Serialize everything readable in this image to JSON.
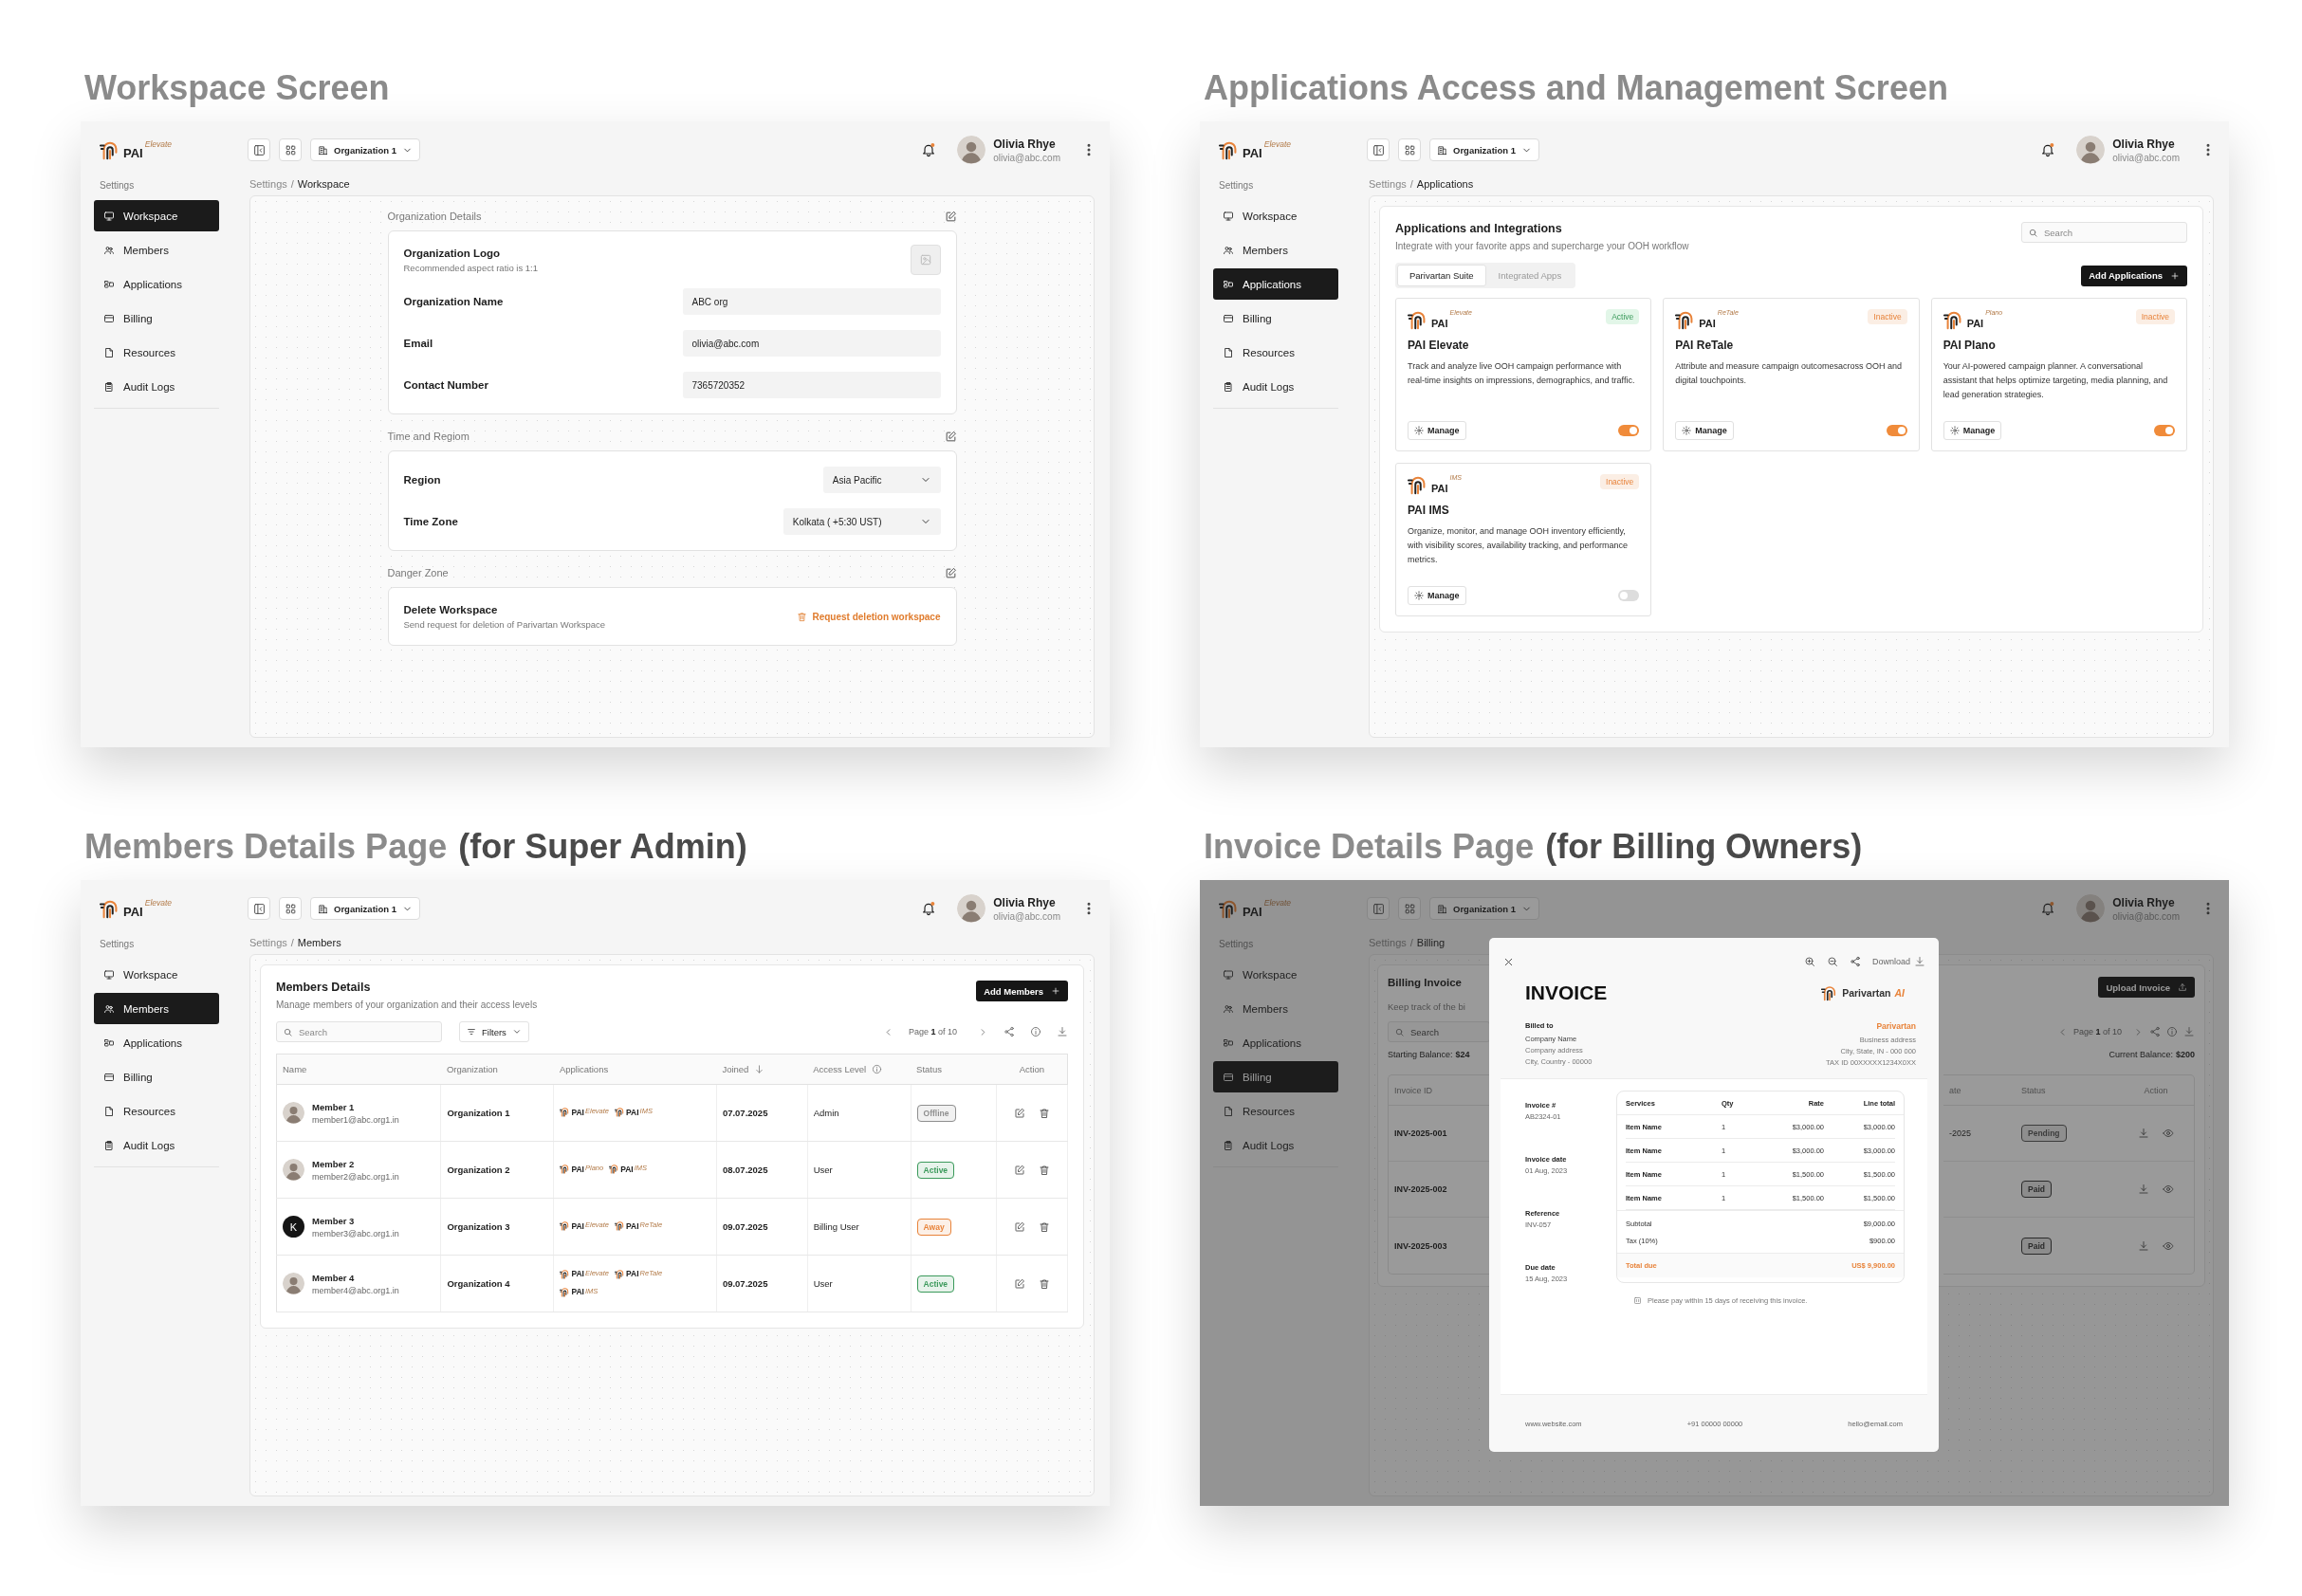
{
  "panels": [
    {
      "kind": "workspace",
      "title": "Workspace Screen",
      "header": {
        "logo": {
          "brand": "PAI",
          "product": "Elevate"
        },
        "organization": "Organization 1",
        "unread": true,
        "user": {
          "name": "Olivia Rhye",
          "email": "olivia@abc.com"
        }
      },
      "sidebar": {
        "heading": "Settings",
        "items": [
          {
            "label": "Workspace",
            "selected": true
          },
          {
            "label": "Members",
            "selected": false
          },
          {
            "label": "Applications",
            "selected": false
          },
          {
            "label": "Billing",
            "selected": false
          },
          {
            "label": "Resources",
            "selected": false
          },
          {
            "label": "Audit Logs",
            "selected": false
          }
        ]
      },
      "breadcrumb": {
        "separator": "/",
        "items": [
          "Settings",
          "Workspace"
        ]
      },
      "sections": [
        {
          "heading": "Organization Details",
          "rows": [
            {
              "kind": "logo",
              "label": "Organization Logo",
              "hint": "Recommended aspect ratio is 1:1"
            },
            {
              "kind": "field",
              "label": "Organization Name",
              "value": "ABC org"
            },
            {
              "kind": "field",
              "label": "Email",
              "value": "olivia@abc.com"
            },
            {
              "kind": "field",
              "label": "Contact Number",
              "value": "7365720352"
            }
          ]
        },
        {
          "heading": "Time and Regiom",
          "rows": [
            {
              "kind": "select",
              "label": "Region",
              "value": "Asia Pacific"
            },
            {
              "kind": "select",
              "label": "Time Zone",
              "value": "Kolkata ( +5:30 UST)"
            }
          ]
        },
        {
          "heading": "Danger Zone",
          "rows": [
            {
              "kind": "danger",
              "label": "Delete Workspace",
              "hint": "Send request for deletion of Parivartan Workspace",
              "action": "Request deletion workspace"
            }
          ]
        }
      ]
    },
    {
      "kind": "applications",
      "title": "Applications Access and Management Screen",
      "header": {
        "logo": {
          "brand": "PAI",
          "product": "Elevate"
        },
        "organization": "Organization 1",
        "unread": true,
        "user": {
          "name": "Olivia Rhye",
          "email": "olivia@abc.com"
        }
      },
      "sidebar": {
        "heading": "Settings",
        "items": [
          {
            "label": "Workspace",
            "selected": false
          },
          {
            "label": "Members",
            "selected": false
          },
          {
            "label": "Applications",
            "selected": true
          },
          {
            "label": "Billing",
            "selected": false
          },
          {
            "label": "Resources",
            "selected": false
          },
          {
            "label": "Audit Logs",
            "selected": false
          }
        ]
      },
      "breadcrumb": {
        "separator": "/",
        "items": [
          "Settings",
          "Applications"
        ]
      },
      "heading": "Applications and Integrations",
      "subtitle": "Integrate with your favorite apps and supercharge your OOH workflow",
      "search_placeholder": "Search",
      "tabs": [
        {
          "label": "Parivartan Suite",
          "selected": true
        },
        {
          "label": "Integrated Apps",
          "selected": false
        }
      ],
      "add_button": "Add Applications",
      "apps": [
        {
          "logo": {
            "brand": "PAI",
            "product": "Elevate"
          },
          "name": "PAI Elevate",
          "status": "Active",
          "active": true,
          "description": "Track and analyze live OOH campaign performance with real-time insights on impressions, demographics, and traffic.",
          "manage": "Manage",
          "on": true
        },
        {
          "logo": {
            "brand": "PAI",
            "product": "ReTale"
          },
          "name": "PAI ReTale",
          "status": "Inactive",
          "active": false,
          "description": "Attribute and measure campaign outcomesacross OOH and digital touchpoints.",
          "manage": "Manage",
          "on": true
        },
        {
          "logo": {
            "brand": "PAI",
            "product": "Plano"
          },
          "name": "PAI Plano",
          "status": "Inactive",
          "active": false,
          "description": "Your AI-powered campaign planner. A conversational assistant that helps optimize targeting, media planning, and lead generation strategies.",
          "manage": "Manage",
          "on": true
        },
        {
          "logo": {
            "brand": "PAI",
            "product": "IMS"
          },
          "name": "PAI IMS",
          "status": "Inactive",
          "active": false,
          "description": "Organize, monitor, and manage OOH inventory efficiently, with visibility scores, availability tracking, and performance metrics.",
          "manage": "Manage",
          "on": false
        }
      ]
    },
    {
      "kind": "members",
      "title": "Members Details Page",
      "title_note": "(for Super Admin)",
      "header": {
        "logo": {
          "brand": "PAI",
          "product": "Elevate"
        },
        "organization": "Organization 1",
        "unread": true,
        "user": {
          "name": "Olivia Rhye",
          "email": "olivia@abc.com"
        }
      },
      "sidebar": {
        "heading": "Settings",
        "items": [
          {
            "label": "Workspace",
            "selected": false
          },
          {
            "label": "Members",
            "selected": true
          },
          {
            "label": "Applications",
            "selected": false
          },
          {
            "label": "Billing",
            "selected": false
          },
          {
            "label": "Resources",
            "selected": false
          },
          {
            "label": "Audit Logs",
            "selected": false
          }
        ]
      },
      "breadcrumb": {
        "separator": "/",
        "items": [
          "Settings",
          "Members"
        ]
      },
      "heading": "Members Details",
      "subtitle": "Manage members of your organization and their access levels",
      "add_button": "Add Members",
      "search_placeholder": "Search",
      "filters": "Filters",
      "pager": "Page **1** of 10",
      "columns": [
        {
          "label": "Name",
          "kind": "plain"
        },
        {
          "label": "Organization",
          "kind": "plain"
        },
        {
          "label": "Applications",
          "kind": "plain"
        },
        {
          "label": "Joined",
          "kind": "sorted"
        },
        {
          "label": "Access Level",
          "kind": "info"
        },
        {
          "label": "Status",
          "kind": "plain"
        },
        {
          "label": "Action",
          "kind": "center"
        }
      ],
      "rows": [
        {
          "kind": "photo",
          "name": "Member 1",
          "email": "member1@abc.org1.in",
          "organization": "Organization 1",
          "apps": [
            {
              "brand": "PAI",
              "product": "Elevate"
            },
            {
              "brand": "PAI",
              "product": "IMS"
            }
          ],
          "joined": "07.07.2025",
          "access": "Admin",
          "status": "Offline",
          "color": "#8f8f8f"
        },
        {
          "kind": "photo",
          "name": "Member 2",
          "email": "member2@abc.org1.in",
          "organization": "Organization 2",
          "apps": [
            {
              "brand": "PAI",
              "product": "Plano"
            },
            {
              "brand": "PAI",
              "product": "IMS"
            }
          ],
          "joined": "08.07.2025",
          "access": "User",
          "status": "Active",
          "color": "#3b9a5b"
        },
        {
          "kind": "initial",
          "initial": "K",
          "name": "Member 3",
          "email": "member3@abc.org1.in",
          "organization": "Organization 3",
          "apps": [
            {
              "brand": "PAI",
              "product": "Elevate"
            },
            {
              "brand": "PAI",
              "product": "ReTale"
            }
          ],
          "joined": "09.07.2025",
          "access": "Billing User",
          "status": "Away",
          "color": "#e8833a"
        },
        {
          "kind": "photo",
          "name": "Member 4",
          "email": "member4@abc.org1.in",
          "organization": "Organization 4",
          "apps": [
            {
              "brand": "PAI",
              "product": "Elevate"
            },
            {
              "brand": "PAI",
              "product": "ReTale"
            },
            {
              "brand": "PAI",
              "product": "IMS"
            }
          ],
          "joined": "09.07.2025",
          "access": "User",
          "status": "Active",
          "color": "#3b9a5b"
        }
      ]
    },
    {
      "kind": "invoice",
      "title": "Invoice Details Page",
      "title_note": "(for Billing Owners)",
      "header": {
        "logo": {
          "brand": "PAI",
          "product": "Elevate"
        },
        "organization": "Organization 1",
        "unread": true,
        "user": {
          "name": "Olivia Rhye",
          "email": "olivia@abc.com"
        }
      },
      "sidebar": {
        "heading": "Settings",
        "items": [
          {
            "label": "Workspace",
            "selected": false
          },
          {
            "label": "Members",
            "selected": false
          },
          {
            "label": "Applications",
            "selected": false
          },
          {
            "label": "Billing",
            "selected": true
          },
          {
            "label": "Resources",
            "selected": false
          },
          {
            "label": "Audit Logs",
            "selected": false
          }
        ]
      },
      "breadcrumb": {
        "separator": "/",
        "items": [
          "Settings",
          "Billing"
        ]
      },
      "billing": {
        "title": "Billing Invoice",
        "subtitle": "Keep track of the bi",
        "search_placeholder": "Search",
        "starting_label": "Starting Balance:",
        "starting_value": "$24",
        "upload": "Upload Invoice",
        "pager": "Page **1** of 10",
        "current_label": "Current Balance:",
        "current_value": "$200",
        "left_column": "Invoice ID",
        "right_columns": [
          "ate",
          "Status",
          "Action"
        ],
        "rows": [
          {
            "id": "INV-2025-001",
            "date": "-2025",
            "status": "Pending",
            "color": "#555555"
          },
          {
            "id": "INV-2025-002",
            "status": "Paid",
            "color": "#333333"
          },
          {
            "id": "INV-2025-003",
            "status": "Paid",
            "color": "#333333"
          }
        ]
      },
      "modal": {
        "download": "Download",
        "title": "INVOICE",
        "brand": {
          "name": "Parivartan",
          "suffix": "AI"
        },
        "billed_to": {
          "label": "Billed to",
          "name": "Company Name",
          "lines": [
            "Company address",
            "City, Country - 00000"
          ]
        },
        "from": {
          "name": "Parivartan",
          "lines": [
            "Business address",
            "City, State, IN - 000 000",
            "TAX ID 00XXXXX1234X0XX"
          ]
        },
        "meta": [
          {
            "label": "Invoice #",
            "value": "AB2324-01"
          },
          {
            "label": "Invoice date",
            "value": "01 Aug, 2023"
          },
          {
            "label": "Reference",
            "value": "INV-057"
          },
          {
            "label": "Due date",
            "value": "15 Aug, 2023"
          }
        ],
        "columns": [
          "Services",
          "Qty",
          "Rate",
          "Line total"
        ],
        "items": [
          [
            "Item Name",
            "1",
            "$3,000.00",
            "$3,000.00"
          ],
          [
            "Item Name",
            "1",
            "$3,000.00",
            "$3,000.00"
          ],
          [
            "Item Name",
            "1",
            "$1,500.00",
            "$1,500.00"
          ],
          [
            "Item Name",
            "1",
            "$1,500.00",
            "$1,500.00"
          ]
        ],
        "summary": [
          [
            "Subtotal",
            "$9,000.00"
          ],
          [
            "Tax (10%)",
            "$900.00"
          ]
        ],
        "total": [
          "Total due",
          "US$ 9,900.00"
        ],
        "note": "Please pay within 15 days of receiving this invoice.",
        "footer": [
          "www.website.com",
          "+91 00000 00000",
          "hello@email.com"
        ]
      }
    }
  ]
}
